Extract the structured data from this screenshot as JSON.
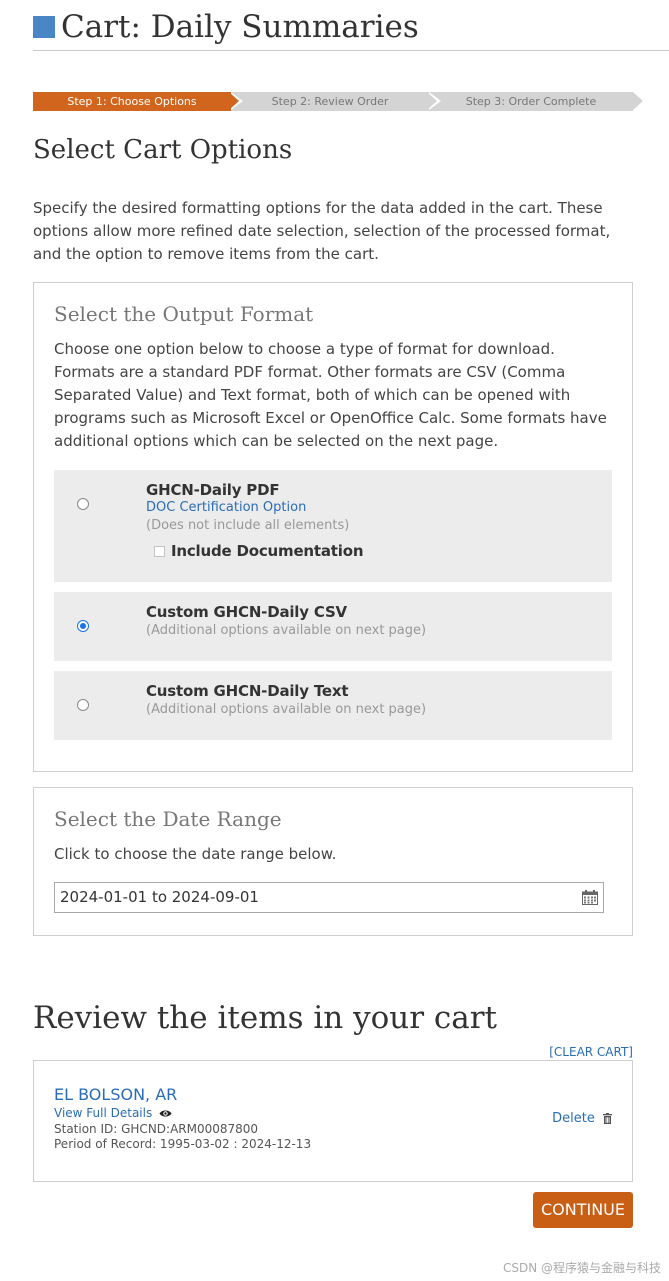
{
  "header": {
    "title": "Cart: Daily Summaries"
  },
  "steps": [
    {
      "label": "Step 1: Choose Options",
      "active": true
    },
    {
      "label": "Step 2: Review Order",
      "active": false
    },
    {
      "label": "Step 3: Order Complete",
      "active": false
    }
  ],
  "options_section": {
    "title": "Select Cart Options",
    "intro": "Specify the desired formatting options for the data added in the cart. These options allow more refined date selection, selection of the processed format, and the option to remove items from the cart."
  },
  "output_format": {
    "title": "Select the Output Format",
    "description": "Choose one option below to choose a type of format for download. Formats are a standard PDF format. Other formats are CSV (Comma Separated Value) and Text format, both of which can be opened with programs such as Microsoft Excel or OpenOffice Calc. Some formats have additional options which can be selected on the next page.",
    "options": [
      {
        "title": "GHCN-Daily PDF",
        "link": "DOC Certification Option",
        "note": "(Does not include all elements)",
        "checkbox_label": "Include Documentation",
        "checkbox_checked": false,
        "selected": false
      },
      {
        "title": "Custom GHCN-Daily CSV",
        "note": "(Additional options available on next page)",
        "selected": true
      },
      {
        "title": "Custom GHCN-Daily Text",
        "note": "(Additional options available on next page)",
        "selected": false
      }
    ]
  },
  "date_range": {
    "title": "Select the Date Range",
    "description": "Click to choose the date range below.",
    "value": "2024-01-01 to 2024-09-01"
  },
  "cart": {
    "title": "Review the items in your cart",
    "clear_label": "[CLEAR CART]",
    "items": [
      {
        "name": "EL BOLSON, AR",
        "details_link": "View Full Details",
        "station_id": "Station ID: GHCND:ARM00087800",
        "period": "Period of Record: 1995-03-02 : 2024-12-13",
        "delete_label": "Delete"
      }
    ],
    "continue_label": "CONTINUE"
  },
  "watermark": "CSDN @程序猿与金融与科技",
  "colors": {
    "accent": "#d1651d",
    "brand_blue": "#4a86c5",
    "link": "#2a6db5",
    "option_bg": "#ececec",
    "button": "#c95e15"
  },
  "icons": [
    "header-square-icon",
    "calendar-icon",
    "eye-icon",
    "trash-icon"
  ]
}
